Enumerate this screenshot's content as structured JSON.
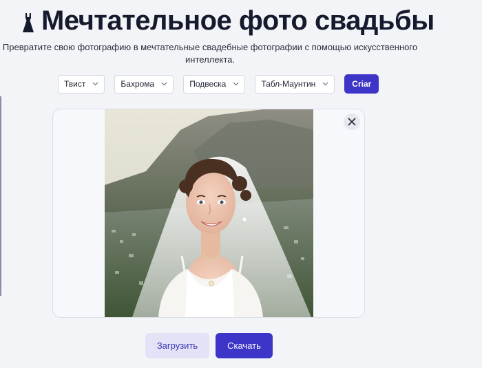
{
  "header": {
    "title": "Мечтательное фото свадьбы",
    "icon": "dress-icon"
  },
  "subtitle": "Превратите свою фотографию в мечтательные свадебные фотографии с помощью искусственного интеллекта.",
  "controls": {
    "selects": [
      {
        "value": "Твист"
      },
      {
        "value": "Бахрома"
      },
      {
        "value": "Подвеска"
      },
      {
        "value": "Табл-Маунтин"
      }
    ],
    "create_label": "Criar"
  },
  "preview": {
    "image": "bride-photo",
    "close_icon": "close-icon"
  },
  "actions": {
    "upload_label": "Загрузить",
    "download_label": "Скачать"
  },
  "colors": {
    "accent": "#3d35c8",
    "accent_soft": "#e4e2f7",
    "background": "#f3f4f8"
  }
}
